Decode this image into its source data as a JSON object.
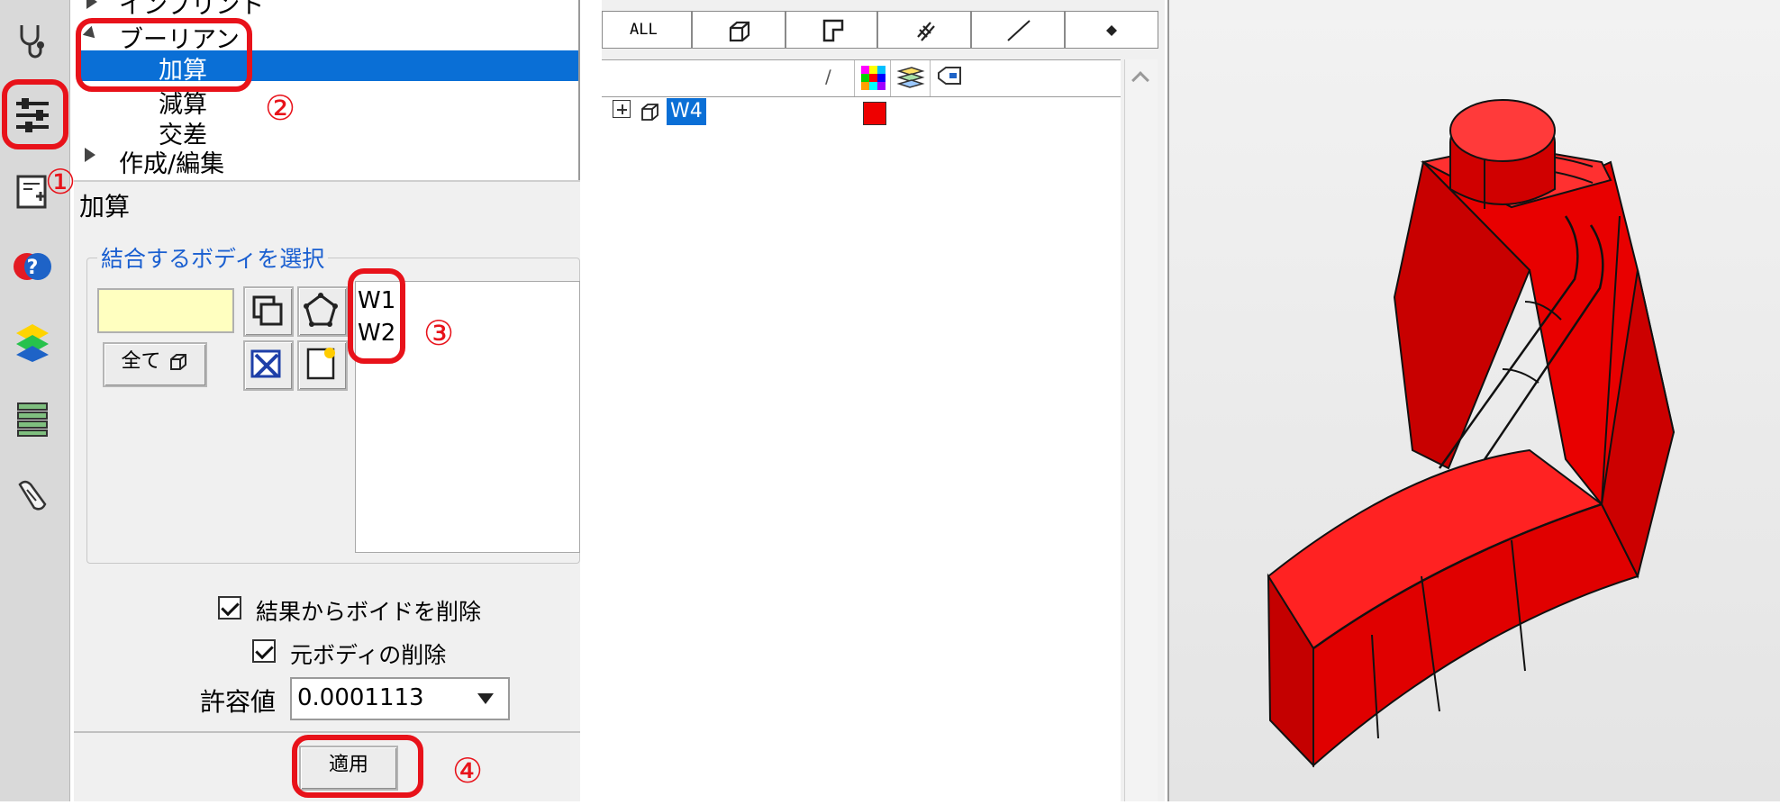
{
  "tree": {
    "items": [
      {
        "label": "インプリント"
      },
      {
        "label": "ブーリアン"
      },
      {
        "label": "加算"
      },
      {
        "label": "減算"
      },
      {
        "label": "交差"
      },
      {
        "label": "作成/編集"
      }
    ]
  },
  "operation": {
    "title": "加算",
    "group_label": "結合するボディを選択",
    "selection_value": "",
    "all_button": "全て",
    "bodies": [
      "W1",
      "W2"
    ],
    "remove_voids_label": "結果からボイドを削除",
    "remove_voids_checked": true,
    "delete_source_label": "元ボディの削除",
    "delete_source_checked": true,
    "tolerance_label": "許容値",
    "tolerance_value": "0.0001113",
    "apply_button": "適用"
  },
  "filter_tabs": [
    "ALL",
    "solid",
    "face",
    "edge-set",
    "line",
    "point"
  ],
  "list": {
    "sort_glyph": "∕",
    "rows": [
      {
        "name": "W4",
        "color": "#ee0000"
      }
    ]
  },
  "annotations": [
    "①",
    "②",
    "③",
    "④"
  ],
  "colors": {
    "annotation": "#e8121a",
    "selection": "#0a6fd6",
    "model": "#ee1010",
    "input_bg": "#ffffc0"
  }
}
